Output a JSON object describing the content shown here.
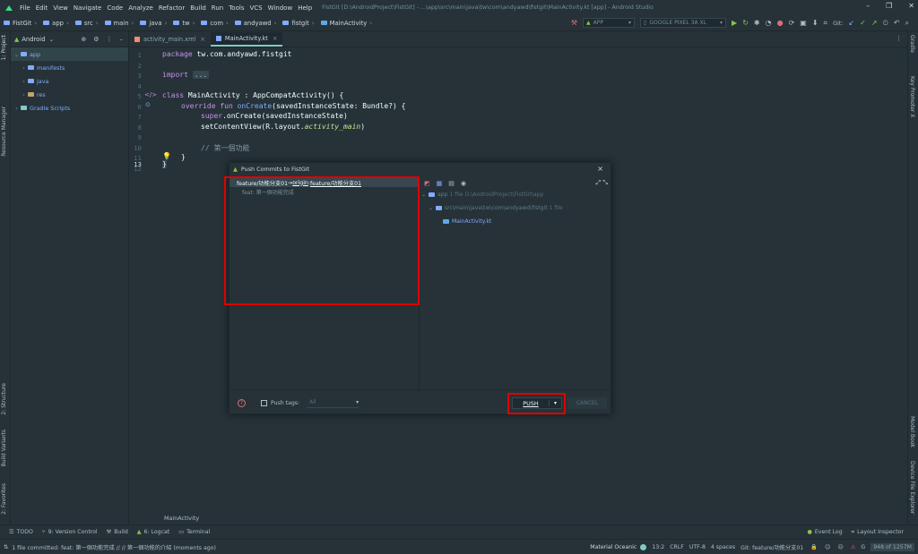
{
  "menubar": {
    "items": [
      "File",
      "Edit",
      "View",
      "Navigate",
      "Code",
      "Analyze",
      "Refactor",
      "Build",
      "Run",
      "Tools",
      "VCS",
      "Window",
      "Help"
    ],
    "title": "FistGit [D:\\AndroidProject\\FistGit] - ...\\app\\src\\main\\java\\tw\\com\\andyawd\\fistgit\\MainActivity.kt [app] - Android Studio",
    "window_buttons": [
      "–",
      "❐",
      "✕"
    ]
  },
  "navbar": {
    "crumbs": [
      "FistGit",
      "app",
      "src",
      "main",
      "java",
      "tw",
      "com",
      "andyawd",
      "fistgit",
      "MainActivity"
    ]
  },
  "toolbar": {
    "run_config": "APP",
    "device": "GOOGLE PIXEL 3A XL",
    "git_label": "Git:"
  },
  "left_strip": {
    "tabs": [
      "1: Project",
      "Resource Manager",
      "2: Structure",
      "Build Variants",
      "2: Favorites"
    ]
  },
  "right_strip": {
    "tabs": [
      "Gradle",
      "Key Promoter X",
      "Model Book",
      "Device File Explorer"
    ]
  },
  "project_panel": {
    "view": "Android",
    "tree": [
      {
        "label": "app",
        "level": 0,
        "expanded": true
      },
      {
        "label": "manifests",
        "level": 1
      },
      {
        "label": "java",
        "level": 1
      },
      {
        "label": "res",
        "level": 1
      },
      {
        "label": "Gradle Scripts",
        "level": 0
      }
    ]
  },
  "editor_tabs": [
    {
      "label": "activity_main.xml",
      "active": false
    },
    {
      "label": "MainActivity.kt",
      "active": true
    }
  ],
  "editor": {
    "line_numbers": [
      "1",
      "2",
      "3",
      "4",
      "5",
      "6",
      "7",
      "8",
      "9",
      "10",
      "11",
      "12",
      "13"
    ],
    "current_line": "13",
    "lines": {
      "l1_kw": "package",
      "l1_rest": " tw.com.andyawd.fistgit",
      "l3_kw": "import",
      "l3_fold": "...",
      "l6_kw": "class",
      "l6_rest": " MainActivity : AppCompatActivity() {",
      "l7_kw": "override fun",
      "l7_fn": " onCreate",
      "l7_rest": "(savedInstanceState: Bundle?) {",
      "l8_kw": "super",
      "l8_rest": ".onCreate(savedInstanceState)",
      "l9_rest": "setContentView(R.layout.",
      "l9_it": "activity_main",
      "l9_end": ")",
      "l11": "// 第一個功能",
      "l12": "}",
      "l13": "}"
    }
  },
  "breadcrumb_bottom": "MainActivity",
  "dialog": {
    "title": "Push Commits to FistGit",
    "commit_branch_from": "feature/功能分支01",
    "commit_arrow": " → ",
    "commit_remote": "origin",
    "commit_colon": " : ",
    "commit_branch_to": "feature/功能分支01",
    "commit_message": "feat: 第一個功能完成",
    "changes": {
      "module": "app",
      "module_info": "1 file  D:\\AndroidProject\\FistGit\\app",
      "path": "src\\main\\java\\tw\\com\\andyawd\\fistgit",
      "path_info": "1 file",
      "file": "MainActivity.kt"
    },
    "push_tags_label": "Push tags:",
    "tags_value": "All",
    "push_label": "PUSH",
    "cancel_label": "CANCEL"
  },
  "tool_windows": [
    "TODO",
    "9: Version Control",
    "Build",
    "6: Logcat",
    "Terminal"
  ],
  "tool_windows_right": [
    "Event Log",
    "Layout Inspector"
  ],
  "status": {
    "message": "1 file committed: feat: 第一個功能完成 // // 第一個功能的介紹 (moments ago)",
    "theme": "Material Oceanic",
    "position": "13:2",
    "line_sep": "CRLF",
    "encoding": "UTF-8",
    "indent": "4 spaces",
    "git_branch": "Git: feature/功能分支01",
    "memory": "948 of 1257M"
  },
  "colors": {
    "highlight_red": "#e00000",
    "accent_teal": "#80cbc4"
  }
}
